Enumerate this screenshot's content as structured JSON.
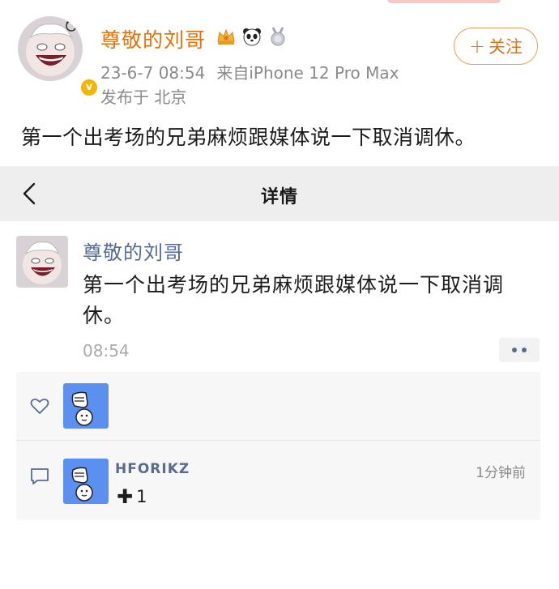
{
  "post": {
    "author": "尊敬的刘哥",
    "time": "23-6-7 08:54",
    "source": "来自iPhone 12 Pro Max",
    "location": "发布于 北京",
    "follow_label": "关注",
    "text": "第一个出考场的兄弟麻烦跟媒体说一下取消调休。"
  },
  "nav": {
    "title": "详情"
  },
  "moment": {
    "author": "尊敬的刘哥",
    "text": "第一个出考场的兄弟麻烦跟媒体说一下取消调休。",
    "time": "08:54"
  },
  "comment": {
    "user": "HFORIKZ",
    "time": "1分钟前",
    "text": "1"
  },
  "colors": {
    "orange": "#e8710a",
    "link_blue": "#576b95",
    "avatar_blue": "#5b8ff0"
  }
}
